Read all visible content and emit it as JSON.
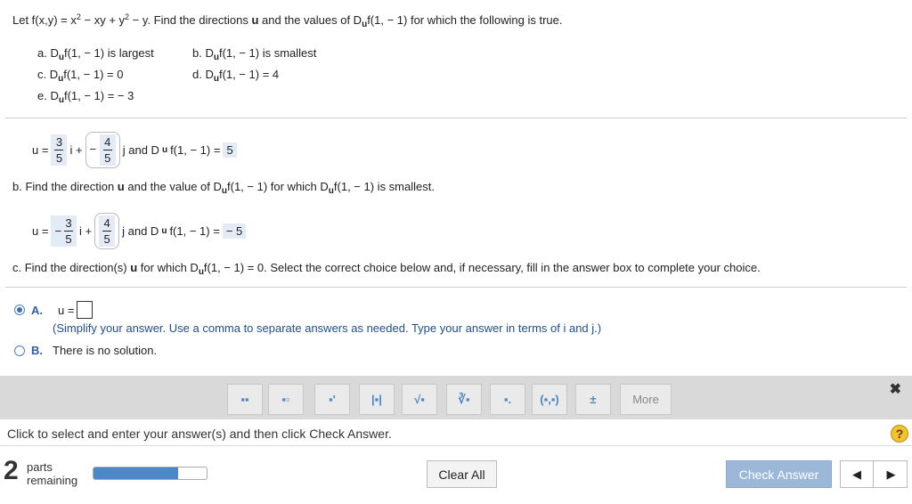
{
  "question": {
    "intro_a": "Let f(x,y) = x",
    "intro_b": " − xy + y",
    "intro_c": " − y. Find the directions ",
    "u": "u",
    "intro_d": " and the values of D",
    "intro_e": "f(1, − 1) for which the following is true.",
    "sup2": "2",
    "sub_u": "u"
  },
  "parts": {
    "a": "a. D",
    "a_tail": "f(1, − 1) is largest",
    "b": "b. D",
    "b_tail": "f(1, − 1) is smallest",
    "c": "c. D",
    "c_tail": "f(1, − 1) = 0",
    "d": "d. D",
    "d_tail": "f(1, − 1) = 4",
    "e": "e. D",
    "e_tail": "f(1, − 1) = − 3"
  },
  "answer_a": {
    "u_eq": "u =",
    "i_num": "3",
    "i_den": "5",
    "i_plus": "i +",
    "j_sign": "−",
    "j_num": "4",
    "j_den": "5",
    "j_and": "j and D",
    "tail": "f(1, − 1) =",
    "value": "5"
  },
  "part_b_prompt": {
    "pre": "b. Find the direction ",
    "u": "u",
    "mid": " and the value of D",
    "mid2": "f(1, − 1) for which D",
    "tail": "f(1, − 1) is smallest."
  },
  "answer_b": {
    "u_eq": "u =",
    "i_sign": "−",
    "i_num": "3",
    "i_den": "5",
    "i_plus": "i +",
    "j_num": "4",
    "j_den": "5",
    "j_and": "j and D",
    "tail": "f(1, − 1) =",
    "value": "− 5"
  },
  "part_c_prompt": {
    "pre": "c. Find the direction(s) ",
    "u": "u",
    "mid": " for which D",
    "tail": "f(1, − 1) = 0. Select the correct choice below and, if necessary, fill in the answer box to complete your choice."
  },
  "choices": {
    "a_letter": "A.",
    "a_eq": "u =",
    "a_hint": "(Simplify your answer. Use a comma to separate answers as needed. Type your answer in terms of i and j.)",
    "b_letter": "B.",
    "b_text": "There is no solution."
  },
  "toolbar": {
    "buttons": [
      "▪▪",
      "▪▫",
      "▪'",
      "|▪|",
      "√▪",
      "∛▪",
      "▪.",
      "(▪,▪)",
      "±"
    ],
    "more": "More",
    "close": "✖"
  },
  "status_text": "Click to select and enter your answer(s) and then click Check Answer.",
  "help": "?",
  "footer": {
    "parts_count": "2",
    "parts_label_1": "parts",
    "parts_label_2": "remaining",
    "progress": 0.75,
    "clear_all": "Clear All",
    "check_answer": "Check Answer",
    "prev": "◀",
    "next": "▶"
  },
  "colors": {
    "accent": "#4c88c9",
    "answer_bg": "#e3ebf6",
    "check_bg": "#9bb8d9",
    "toolbar_bg": "#d9d9d9"
  }
}
